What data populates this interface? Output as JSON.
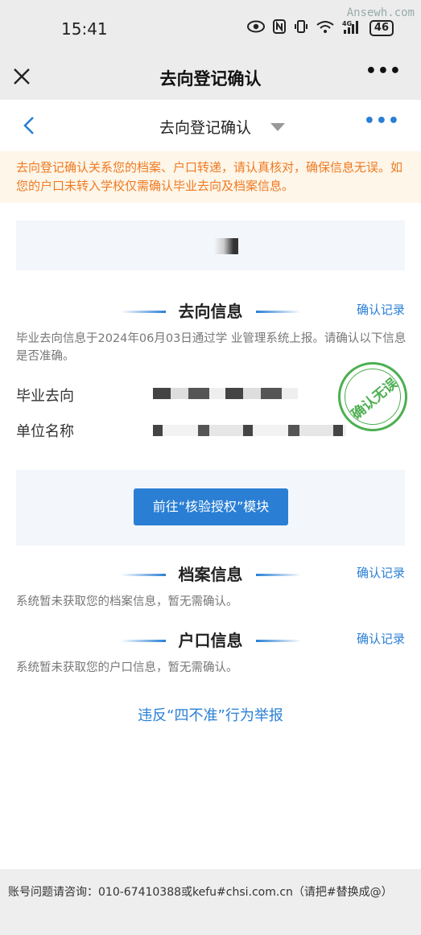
{
  "status_bar": {
    "time": "15:41",
    "battery": "46",
    "watermark": "Ansewh.com"
  },
  "top_nav": {
    "title": "去向登记确认",
    "more": "•••"
  },
  "sub_nav": {
    "title": "去向登记确认",
    "more": "•••"
  },
  "notice": "去向登记确认关系您的档案、户口转递，请认真核对，确保信息无误。如您的户口未转入学校仅需确认毕业去向及档案信息。",
  "destination": {
    "title": "去向信息",
    "record_link": "确认记录",
    "desc": "毕业去向信息于2024年06月03日通过学 业管理系统上报。请确认以下信息是否准确。",
    "fields": [
      {
        "label": "毕业去向"
      },
      {
        "label": "单位名称"
      }
    ],
    "stamp": "确认无误"
  },
  "verify_button": "前往“核验授权”模块",
  "archive": {
    "title": "档案信息",
    "record_link": "确认记录",
    "desc": "系统暂未获取您的档案信息，暂无需确认。"
  },
  "hukou": {
    "title": "户口信息",
    "record_link": "确认记录",
    "desc": "系统暂未获取您的户口信息，暂无需确认。"
  },
  "report_link": "违反“四不准”行为举报",
  "footer": "账号问题请咨询：010-67410388或kefu#chsi.com.cn（请把#替换成@）"
}
